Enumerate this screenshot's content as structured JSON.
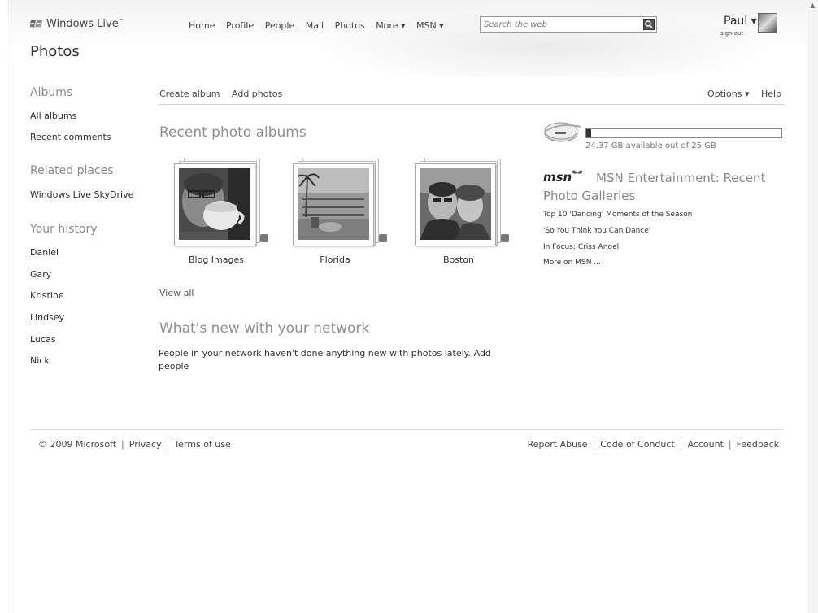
{
  "header": {
    "brand": "Windows Live",
    "brand_tm": "™",
    "page_title": "Photos",
    "nav": [
      "Home",
      "Profile",
      "People",
      "Mail",
      "Photos",
      "More ▾",
      "MSN ▾"
    ],
    "search_placeholder": "Search the web",
    "user_name": "Paul ▾",
    "sign_out": "sign out"
  },
  "sidebar": {
    "albums_heading": "Albums",
    "albums_links": [
      "All albums",
      "Recent comments"
    ],
    "related_heading": "Related places",
    "related_links": [
      "Windows Live SkyDrive"
    ],
    "history_heading": "Your history",
    "history_links": [
      "Daniel",
      "Gary",
      "Kristine",
      "Lindsey",
      "Lucas",
      "Nick"
    ]
  },
  "toolbar": {
    "create_album": "Create album",
    "add_photos": "Add photos",
    "options": "Options ▾",
    "help": "Help"
  },
  "main": {
    "recent_heading": "Recent photo albums",
    "albums": [
      {
        "name": "Blog Images"
      },
      {
        "name": "Florida"
      },
      {
        "name": "Boston"
      }
    ],
    "view_all": "View all",
    "network_heading": "What's new with your network",
    "network_text": "People in your network haven't done anything new with photos lately. Add people"
  },
  "storage": {
    "used_fraction": 0.025,
    "text": "24.37 GB available out of 25 GB"
  },
  "msn": {
    "logo": "msn",
    "title_line1": "MSN Entertainment: Recent",
    "title_line2": "Photo Galleries",
    "links": [
      "Top 10 'Dancing' Moments of the Season",
      "'So You Think You Can Dance'",
      "In Focus: Criss Angel",
      "More on MSN ..."
    ]
  },
  "footer": {
    "copyright": "© 2009 Microsoft",
    "privacy": "Privacy",
    "terms": "Terms of use",
    "report_abuse": "Report Abuse",
    "code_of_conduct": "Code of Conduct",
    "account": "Account",
    "feedback": "Feedback"
  }
}
